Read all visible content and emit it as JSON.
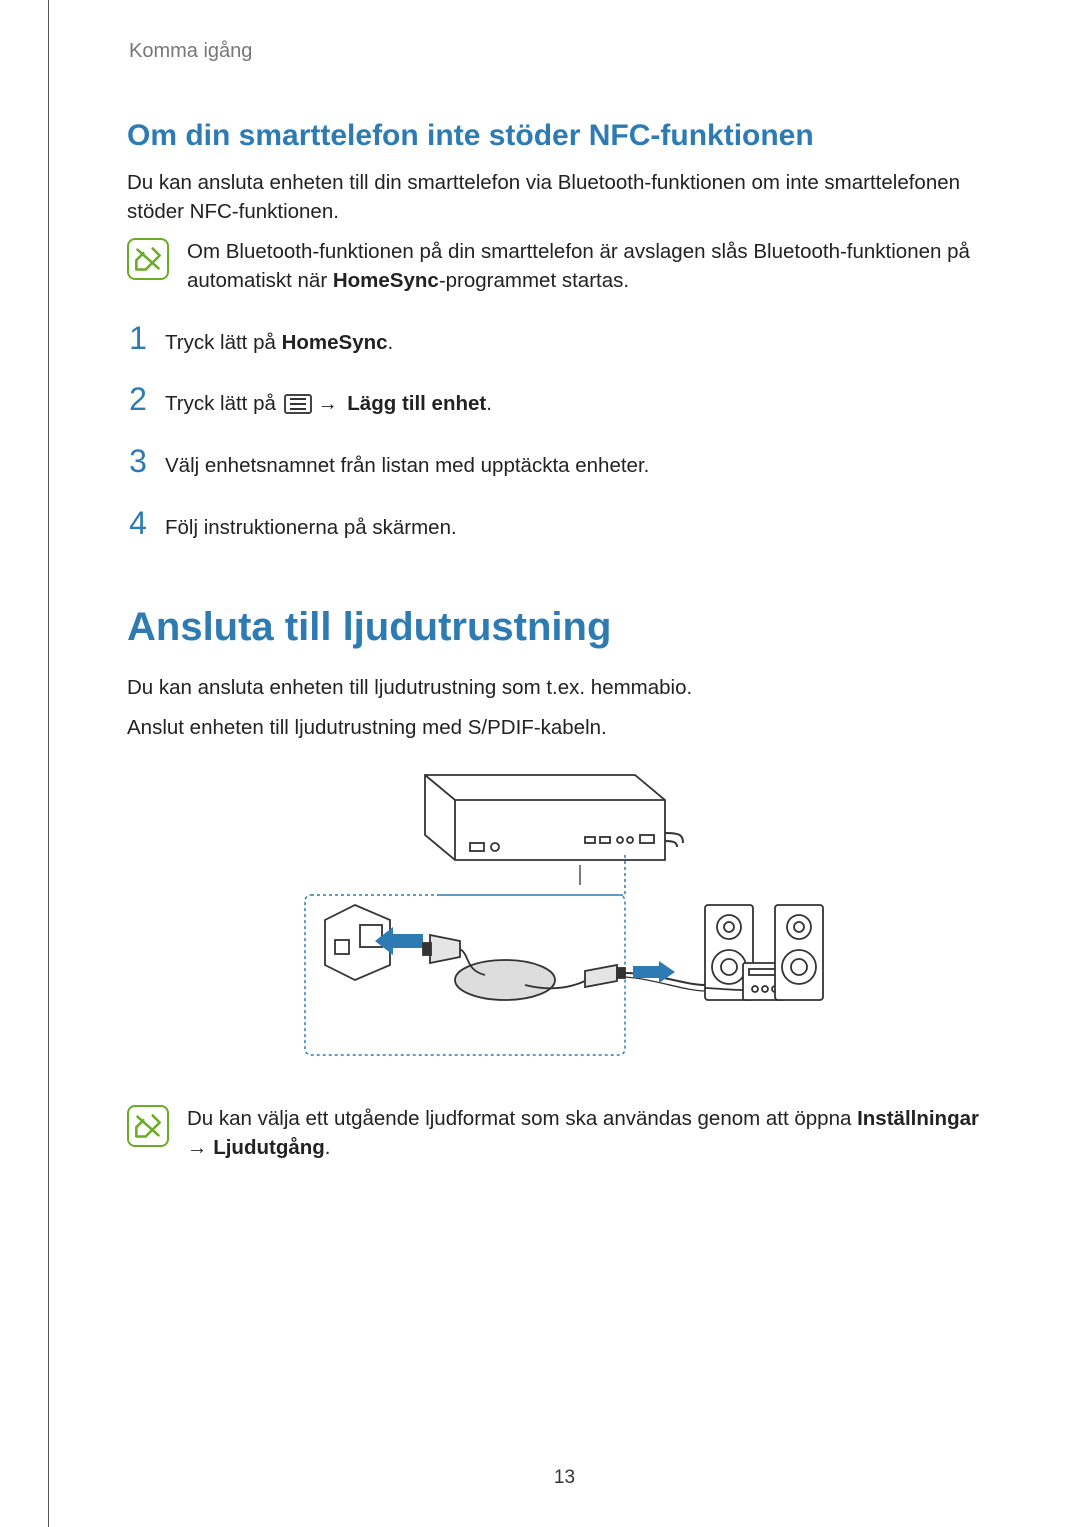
{
  "header": {
    "breadcrumb": "Komma igång"
  },
  "section1": {
    "title": "Om din smarttelefon inte stöder NFC-funktionen",
    "intro": "Du kan ansluta enheten till din smarttelefon via Bluetooth-funktionen om inte smarttelefonen stöder NFC-funktionen.",
    "note_pre": "Om Bluetooth-funktionen på din smarttelefon är avslagen slås Bluetooth-funktionen på automatiskt när ",
    "note_bold": "HomeSync",
    "note_post": "-programmet startas."
  },
  "steps": {
    "s1_pre": "Tryck lätt på ",
    "s1_bold": "HomeSync",
    "s1_post": ".",
    "s2_pre": "Tryck lätt på ",
    "s2_arrow": "→",
    "s2_bold": "Lägg till enhet",
    "s2_post": ".",
    "s3": "Välj enhetsnamnet från listan med upptäckta enheter.",
    "s4": "Följ instruktionerna på skärmen."
  },
  "section2": {
    "title": "Ansluta till ljudutrustning",
    "p1": "Du kan ansluta enheten till ljudutrustning som t.ex. hemmabio.",
    "p2": "Anslut enheten till ljudutrustning med S/PDIF-kabeln.",
    "note_pre": "Du kan välja ett utgående ljudformat som ska användas genom att öppna ",
    "note_bold1": "Inställningar",
    "note_arrow": " → ",
    "note_bold2": "Ljudutgång",
    "note_post": "."
  },
  "page_number": "13"
}
